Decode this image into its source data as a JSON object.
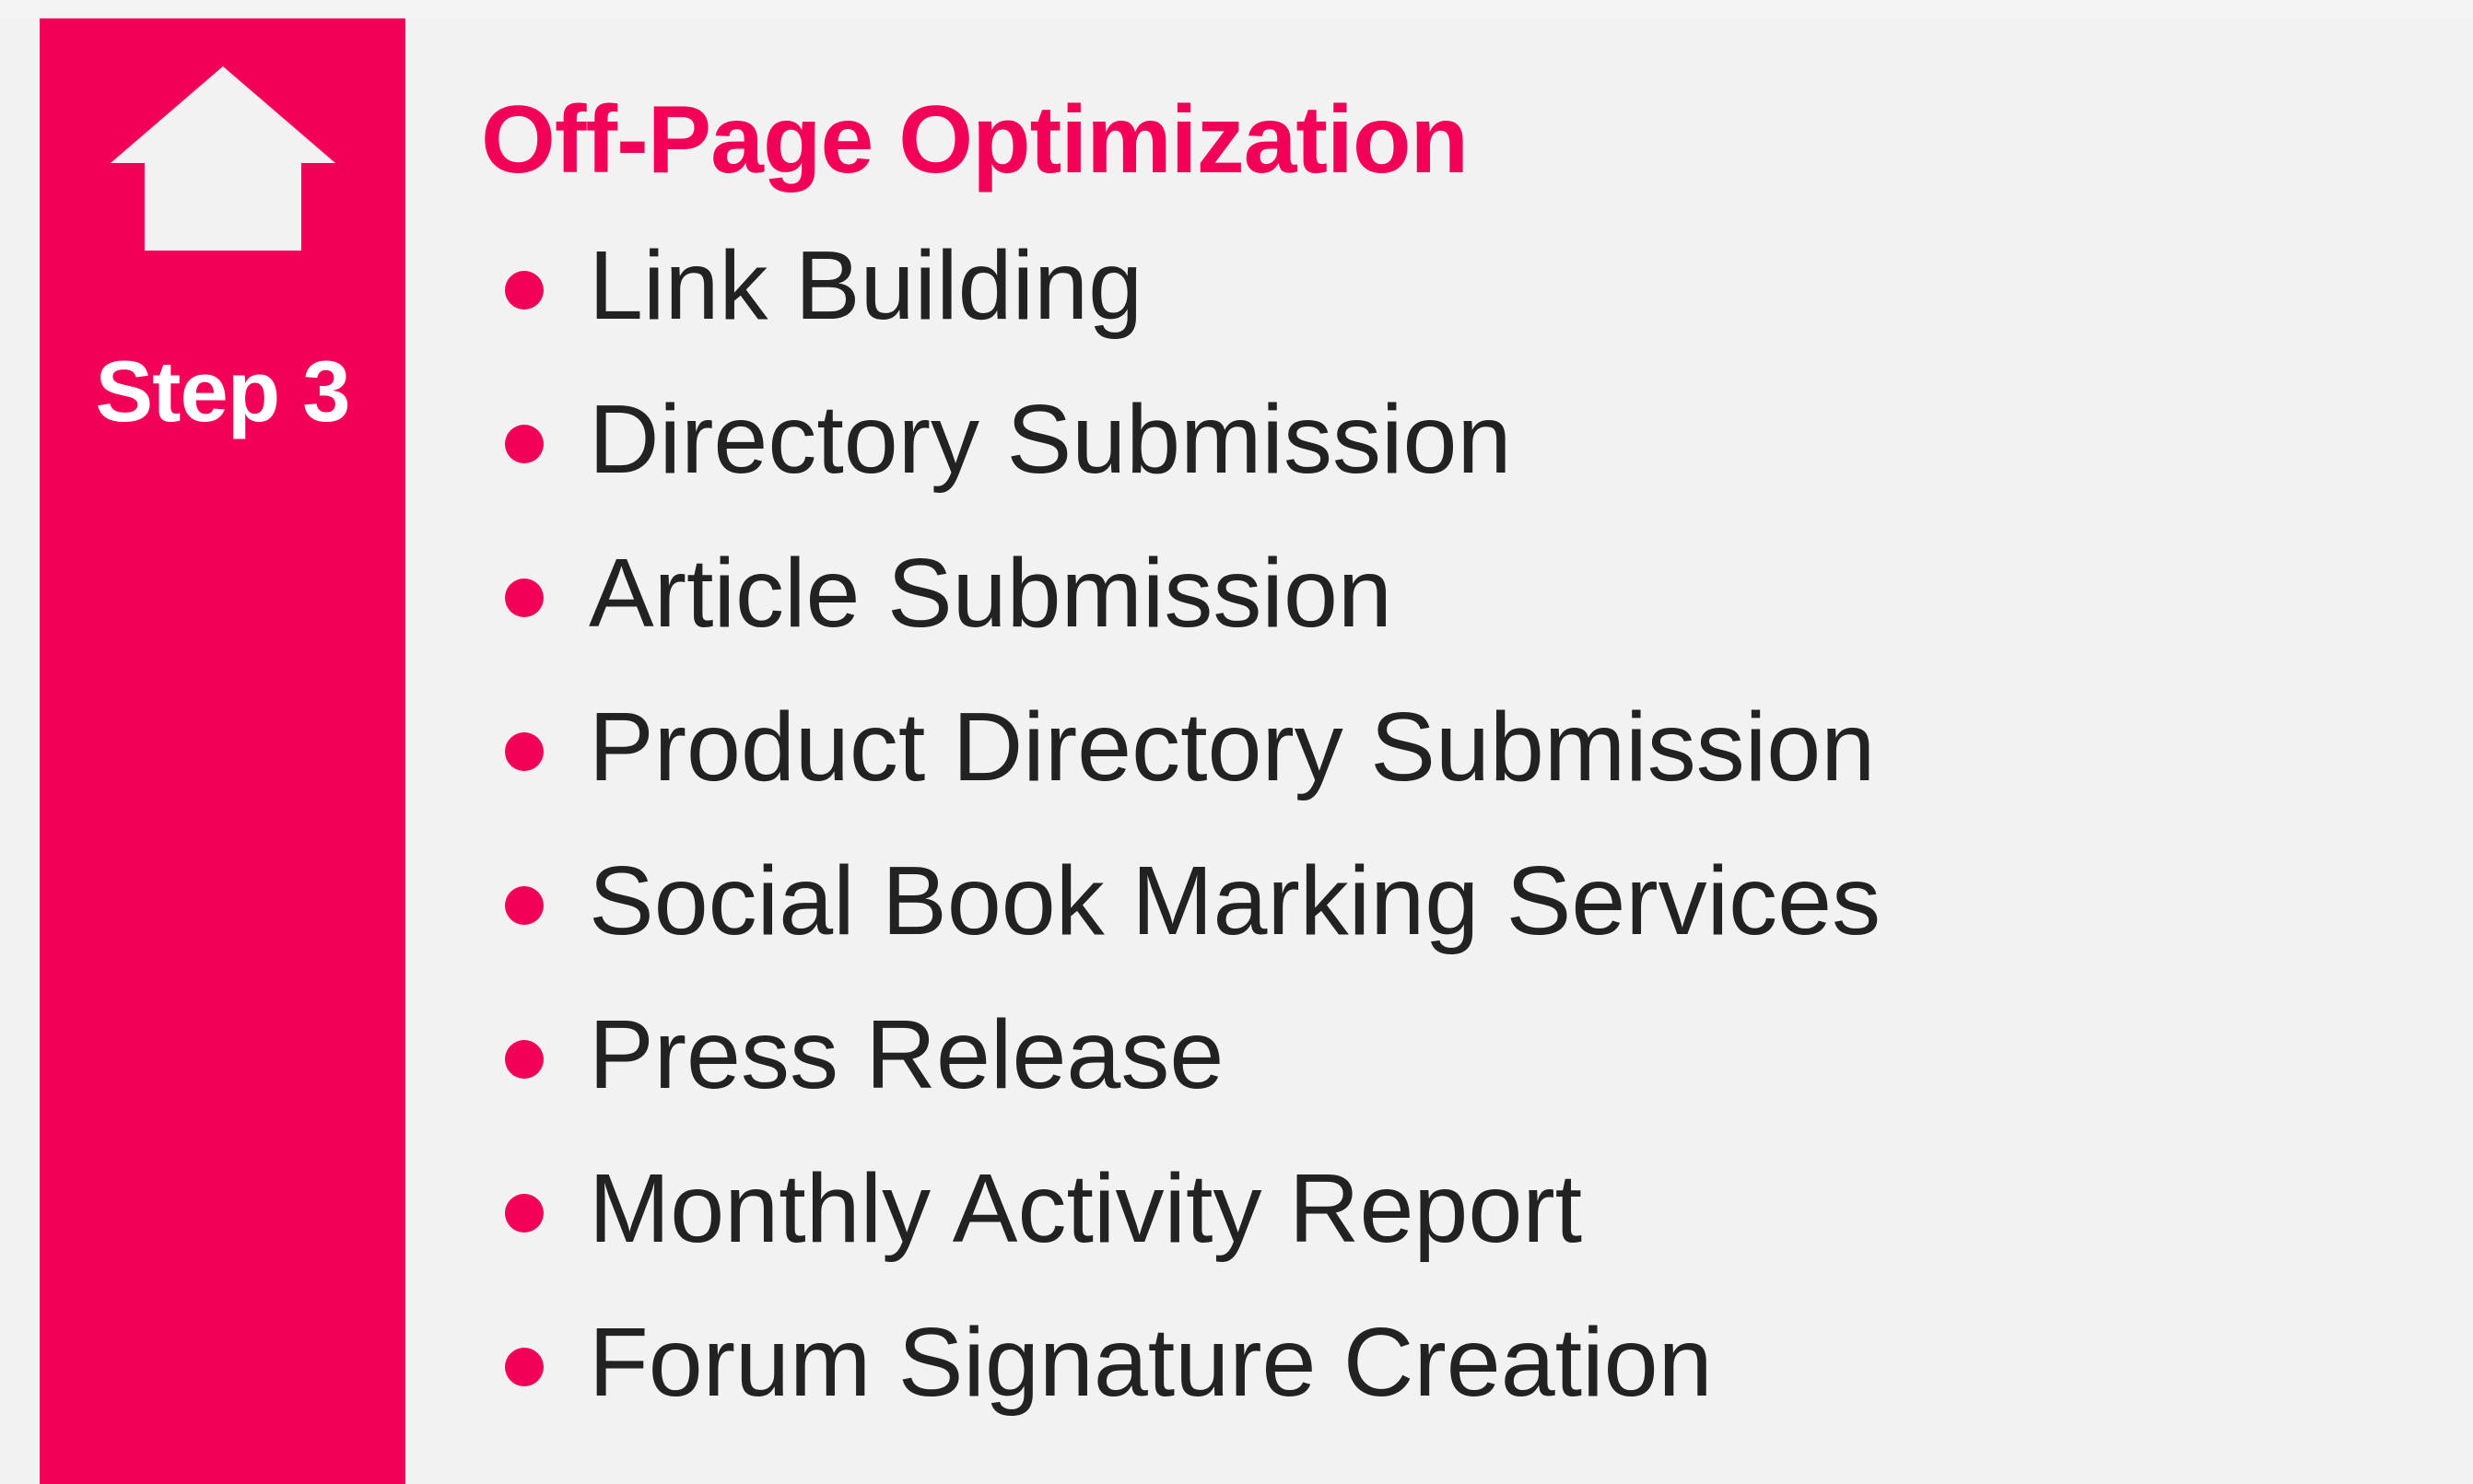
{
  "step": {
    "label": "Step 3",
    "icon": "home-icon"
  },
  "section": {
    "title": "Off-Page Optimization",
    "items": [
      "Link Building",
      "Directory Submission",
      "Article Submission",
      "Product Directory Submission",
      "Social Book Marking Services",
      "Press Release",
      "Monthly Activity Report",
      "Forum Signature Creation"
    ]
  },
  "colors": {
    "accent": "#f20057",
    "background": "#f2f2f2",
    "text": "#222222",
    "icon": "#f2f2f2"
  }
}
